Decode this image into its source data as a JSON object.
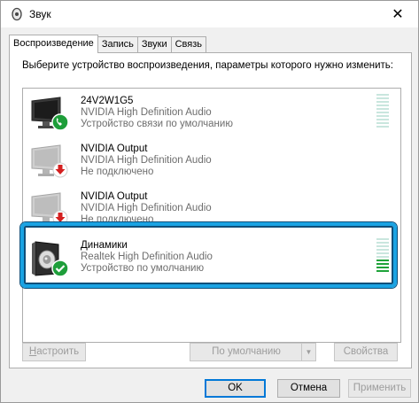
{
  "window": {
    "title": "Звук",
    "close_glyph": "✕"
  },
  "tabs": [
    {
      "label": "Воспроизведение",
      "active": true
    },
    {
      "label": "Запись",
      "active": false
    },
    {
      "label": "Звуки",
      "active": false
    },
    {
      "label": "Связь",
      "active": false
    }
  ],
  "description": "Выберите устройство воспроизведения, параметры которого нужно изменить:",
  "devices": [
    {
      "name": "24V2W1G5",
      "driver": "NVIDIA High Definition Audio",
      "status": "Устройство связи по умолчанию",
      "icon": "monitor-icon",
      "badge": "phone-badge-icon",
      "level_segments": 10,
      "level_active": 0
    },
    {
      "name": "NVIDIA Output",
      "driver": "NVIDIA High Definition Audio",
      "status": "Не подключено",
      "icon": "monitor-icon",
      "badge": "down-arrow-badge-icon",
      "level_segments": 0,
      "level_active": 0
    },
    {
      "name": "NVIDIA Output",
      "driver": "NVIDIA High Definition Audio",
      "status": "Не подключено",
      "icon": "monitor-icon",
      "badge": "down-arrow-badge-icon",
      "level_segments": 0,
      "level_active": 0
    },
    {
      "name": "Динамики",
      "driver": "Realtek High Definition Audio",
      "status": "Устройство по умолчанию",
      "icon": "speaker-icon",
      "badge": "check-badge-icon",
      "level_segments": 10,
      "level_active": 4
    }
  ],
  "buttons": {
    "configure": "Настроить",
    "configure_accel": "Н",
    "default": "По умолчанию",
    "properties": "Свойства",
    "ok": "OK",
    "cancel": "Отмена",
    "apply": "Применить"
  },
  "colors": {
    "highlight_border": "#1aa3e3",
    "default_badge_green": "#1e9e3a",
    "disconnected_red": "#d42020",
    "level_on": "#1fa33a",
    "level_off": "#c9e6de"
  }
}
